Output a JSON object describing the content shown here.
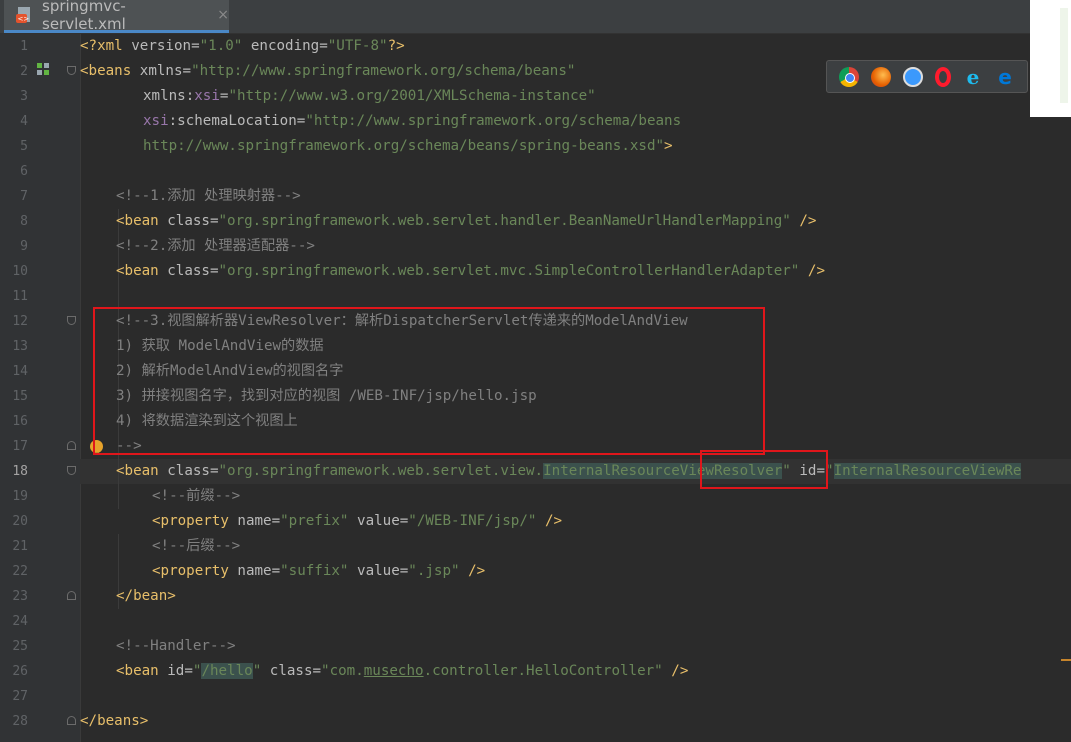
{
  "tab": {
    "title": "springmvc-servlet.xml",
    "close": "×",
    "icon": "xml-file-icon"
  },
  "browsers": [
    "chrome-icon",
    "firefox-icon",
    "safari-icon",
    "opera-icon",
    "ie-icon",
    "edge-icon"
  ],
  "line_numbers": [
    "1",
    "2",
    "3",
    "4",
    "5",
    "6",
    "7",
    "8",
    "9",
    "10",
    "11",
    "12",
    "13",
    "14",
    "15",
    "16",
    "17",
    "18",
    "19",
    "20",
    "21",
    "22",
    "23",
    "24",
    "25",
    "26",
    "27",
    "28"
  ],
  "current_line": "18",
  "code": {
    "l1": [
      "<?",
      "xml ",
      "version",
      "=",
      "\"1.0\"",
      " ",
      "encoding",
      "=",
      "\"UTF-8\"",
      "?>"
    ],
    "l2": [
      "<beans ",
      "xmlns",
      "=",
      "\"http://www.springframework.org/schema/beans\""
    ],
    "l3": [
      "xmlns",
      ":",
      "xsi",
      "=",
      "\"http://www.w3.org/2001/XMLSchema-instance\""
    ],
    "l4": [
      "xsi",
      ":",
      "schemaLocation",
      "=",
      "\"http://www.springframework.org/schema/beans"
    ],
    "l5": [
      "http://www.springframework.org/schema/beans/spring-beans.xsd\"",
      ">"
    ],
    "l7": "<!--1.添加 处理映射器-->",
    "l8": [
      "<bean ",
      "class",
      "=",
      "\"org.springframework.web.servlet.handler.BeanNameUrlHandlerMapping\"",
      " />"
    ],
    "l9": "<!--2.添加 处理器适配器-->",
    "l10": [
      "<bean ",
      "class",
      "=",
      "\"org.springframework.web.servlet.mvc.SimpleControllerHandlerAdapter\"",
      " />"
    ],
    "l12": "<!--3.视图解析器ViewResolver：解析DispatcherServlet传递来的ModelAndView",
    "l13": "1) 获取 ModelAndView的数据",
    "l14": "2) 解析ModelAndView的视图名字",
    "l15": "3) 拼接视图名字，找到对应的视图 /WEB-INF/jsp/hello.jsp",
    "l16": "4) 将数据渲染到这个视图上",
    "l17": "-->",
    "l18": [
      "<bean ",
      "class",
      "=",
      "\"org.springframework.web.servlet.view.",
      "InternalResourceViewResolver",
      "\"",
      " ",
      "id",
      "=",
      "\"",
      "InternalResourceViewRe"
    ],
    "l19": "<!--前缀-->",
    "l20": [
      "<property ",
      "name",
      "=",
      "\"prefix\"",
      " ",
      "value",
      "=",
      "\"/WEB-INF/jsp/\"",
      " />"
    ],
    "l21": "<!--后缀-->",
    "l22": [
      "<property ",
      "name",
      "=",
      "\"suffix\"",
      " ",
      "value",
      "=",
      "\".jsp\"",
      " />"
    ],
    "l23": "</bean>",
    "l25": "<!--Handler-->",
    "l26": [
      "<bean ",
      "id",
      "=",
      "\"",
      "/hello",
      "\"",
      " ",
      "class",
      "=",
      "\"com.",
      "musecho",
      ".controller.HelloController\"",
      " />"
    ],
    "l28": "</beans>"
  }
}
